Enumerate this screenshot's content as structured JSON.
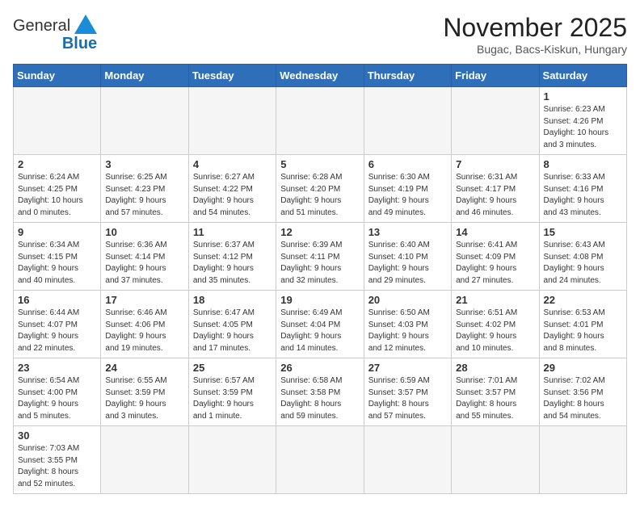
{
  "logo": {
    "line1": "General",
    "line2": "Blue"
  },
  "title": "November 2025",
  "location": "Bugac, Bacs-Kiskun, Hungary",
  "weekdays": [
    "Sunday",
    "Monday",
    "Tuesday",
    "Wednesday",
    "Thursday",
    "Friday",
    "Saturday"
  ],
  "days": [
    {
      "date": "",
      "info": ""
    },
    {
      "date": "",
      "info": ""
    },
    {
      "date": "",
      "info": ""
    },
    {
      "date": "",
      "info": ""
    },
    {
      "date": "",
      "info": ""
    },
    {
      "date": "",
      "info": ""
    },
    {
      "date": "1",
      "info": "Sunrise: 6:23 AM\nSunset: 4:26 PM\nDaylight: 10 hours\nand 3 minutes."
    },
    {
      "date": "2",
      "info": "Sunrise: 6:24 AM\nSunset: 4:25 PM\nDaylight: 10 hours\nand 0 minutes."
    },
    {
      "date": "3",
      "info": "Sunrise: 6:25 AM\nSunset: 4:23 PM\nDaylight: 9 hours\nand 57 minutes."
    },
    {
      "date": "4",
      "info": "Sunrise: 6:27 AM\nSunset: 4:22 PM\nDaylight: 9 hours\nand 54 minutes."
    },
    {
      "date": "5",
      "info": "Sunrise: 6:28 AM\nSunset: 4:20 PM\nDaylight: 9 hours\nand 51 minutes."
    },
    {
      "date": "6",
      "info": "Sunrise: 6:30 AM\nSunset: 4:19 PM\nDaylight: 9 hours\nand 49 minutes."
    },
    {
      "date": "7",
      "info": "Sunrise: 6:31 AM\nSunset: 4:17 PM\nDaylight: 9 hours\nand 46 minutes."
    },
    {
      "date": "8",
      "info": "Sunrise: 6:33 AM\nSunset: 4:16 PM\nDaylight: 9 hours\nand 43 minutes."
    },
    {
      "date": "9",
      "info": "Sunrise: 6:34 AM\nSunset: 4:15 PM\nDaylight: 9 hours\nand 40 minutes."
    },
    {
      "date": "10",
      "info": "Sunrise: 6:36 AM\nSunset: 4:14 PM\nDaylight: 9 hours\nand 37 minutes."
    },
    {
      "date": "11",
      "info": "Sunrise: 6:37 AM\nSunset: 4:12 PM\nDaylight: 9 hours\nand 35 minutes."
    },
    {
      "date": "12",
      "info": "Sunrise: 6:39 AM\nSunset: 4:11 PM\nDaylight: 9 hours\nand 32 minutes."
    },
    {
      "date": "13",
      "info": "Sunrise: 6:40 AM\nSunset: 4:10 PM\nDaylight: 9 hours\nand 29 minutes."
    },
    {
      "date": "14",
      "info": "Sunrise: 6:41 AM\nSunset: 4:09 PM\nDaylight: 9 hours\nand 27 minutes."
    },
    {
      "date": "15",
      "info": "Sunrise: 6:43 AM\nSunset: 4:08 PM\nDaylight: 9 hours\nand 24 minutes."
    },
    {
      "date": "16",
      "info": "Sunrise: 6:44 AM\nSunset: 4:07 PM\nDaylight: 9 hours\nand 22 minutes."
    },
    {
      "date": "17",
      "info": "Sunrise: 6:46 AM\nSunset: 4:06 PM\nDaylight: 9 hours\nand 19 minutes."
    },
    {
      "date": "18",
      "info": "Sunrise: 6:47 AM\nSunset: 4:05 PM\nDaylight: 9 hours\nand 17 minutes."
    },
    {
      "date": "19",
      "info": "Sunrise: 6:49 AM\nSunset: 4:04 PM\nDaylight: 9 hours\nand 14 minutes."
    },
    {
      "date": "20",
      "info": "Sunrise: 6:50 AM\nSunset: 4:03 PM\nDaylight: 9 hours\nand 12 minutes."
    },
    {
      "date": "21",
      "info": "Sunrise: 6:51 AM\nSunset: 4:02 PM\nDaylight: 9 hours\nand 10 minutes."
    },
    {
      "date": "22",
      "info": "Sunrise: 6:53 AM\nSunset: 4:01 PM\nDaylight: 9 hours\nand 8 minutes."
    },
    {
      "date": "23",
      "info": "Sunrise: 6:54 AM\nSunset: 4:00 PM\nDaylight: 9 hours\nand 5 minutes."
    },
    {
      "date": "24",
      "info": "Sunrise: 6:55 AM\nSunset: 3:59 PM\nDaylight: 9 hours\nand 3 minutes."
    },
    {
      "date": "25",
      "info": "Sunrise: 6:57 AM\nSunset: 3:59 PM\nDaylight: 9 hours\nand 1 minute."
    },
    {
      "date": "26",
      "info": "Sunrise: 6:58 AM\nSunset: 3:58 PM\nDaylight: 8 hours\nand 59 minutes."
    },
    {
      "date": "27",
      "info": "Sunrise: 6:59 AM\nSunset: 3:57 PM\nDaylight: 8 hours\nand 57 minutes."
    },
    {
      "date": "28",
      "info": "Sunrise: 7:01 AM\nSunset: 3:57 PM\nDaylight: 8 hours\nand 55 minutes."
    },
    {
      "date": "29",
      "info": "Sunrise: 7:02 AM\nSunset: 3:56 PM\nDaylight: 8 hours\nand 54 minutes."
    },
    {
      "date": "30",
      "info": "Sunrise: 7:03 AM\nSunset: 3:55 PM\nDaylight: 8 hours\nand 52 minutes."
    },
    {
      "date": "",
      "info": ""
    },
    {
      "date": "",
      "info": ""
    },
    {
      "date": "",
      "info": ""
    },
    {
      "date": "",
      "info": ""
    },
    {
      "date": "",
      "info": ""
    },
    {
      "date": "",
      "info": ""
    }
  ]
}
